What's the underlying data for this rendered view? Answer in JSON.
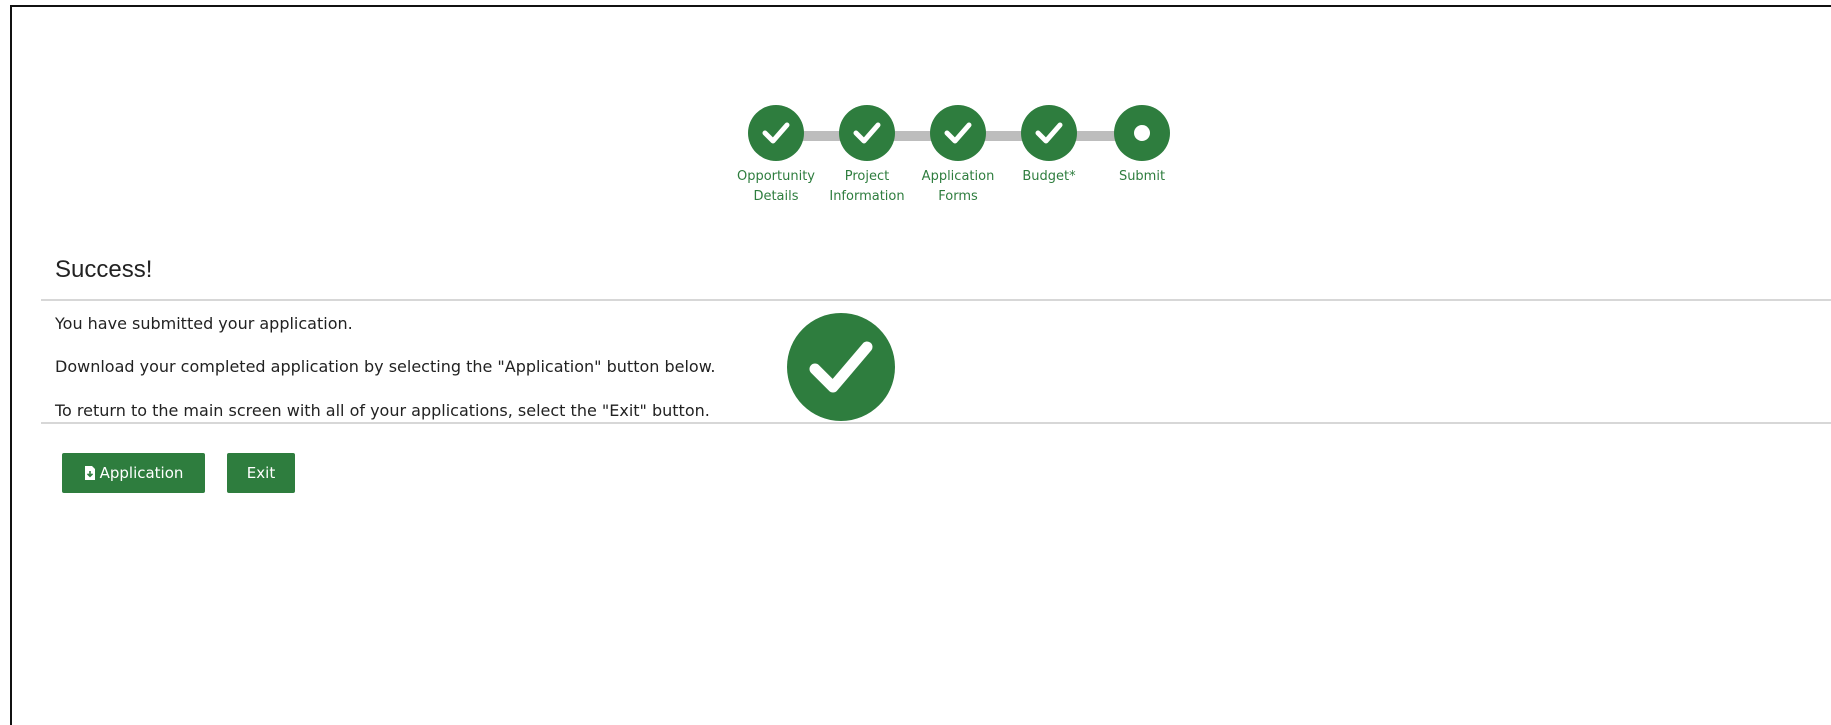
{
  "stepper": {
    "steps": [
      {
        "label": "Opportunity\nDetails",
        "state": "complete",
        "icon": "check-icon"
      },
      {
        "label": "Project\nInformation",
        "state": "complete",
        "icon": "check-icon"
      },
      {
        "label": "Application\nForms",
        "state": "complete",
        "icon": "check-icon"
      },
      {
        "label": "Budget*",
        "state": "complete",
        "icon": "check-icon"
      },
      {
        "label": "Submit",
        "state": "current",
        "icon": "dot-icon"
      }
    ]
  },
  "content": {
    "title": "Success!",
    "messages": [
      "You have submitted your application.",
      "Download your completed application by selecting the \"Application\" button below.",
      "To return to the main screen with all of your applications, select the \"Exit\" button."
    ],
    "status_icon": "success-check-icon"
  },
  "actions": {
    "application_label": "Application",
    "application_icon": "file-download-icon",
    "exit_label": "Exit"
  },
  "colors": {
    "accent": "#2e7d3e",
    "connector": "#bdbdbd",
    "rule": "#d7d7d7"
  }
}
